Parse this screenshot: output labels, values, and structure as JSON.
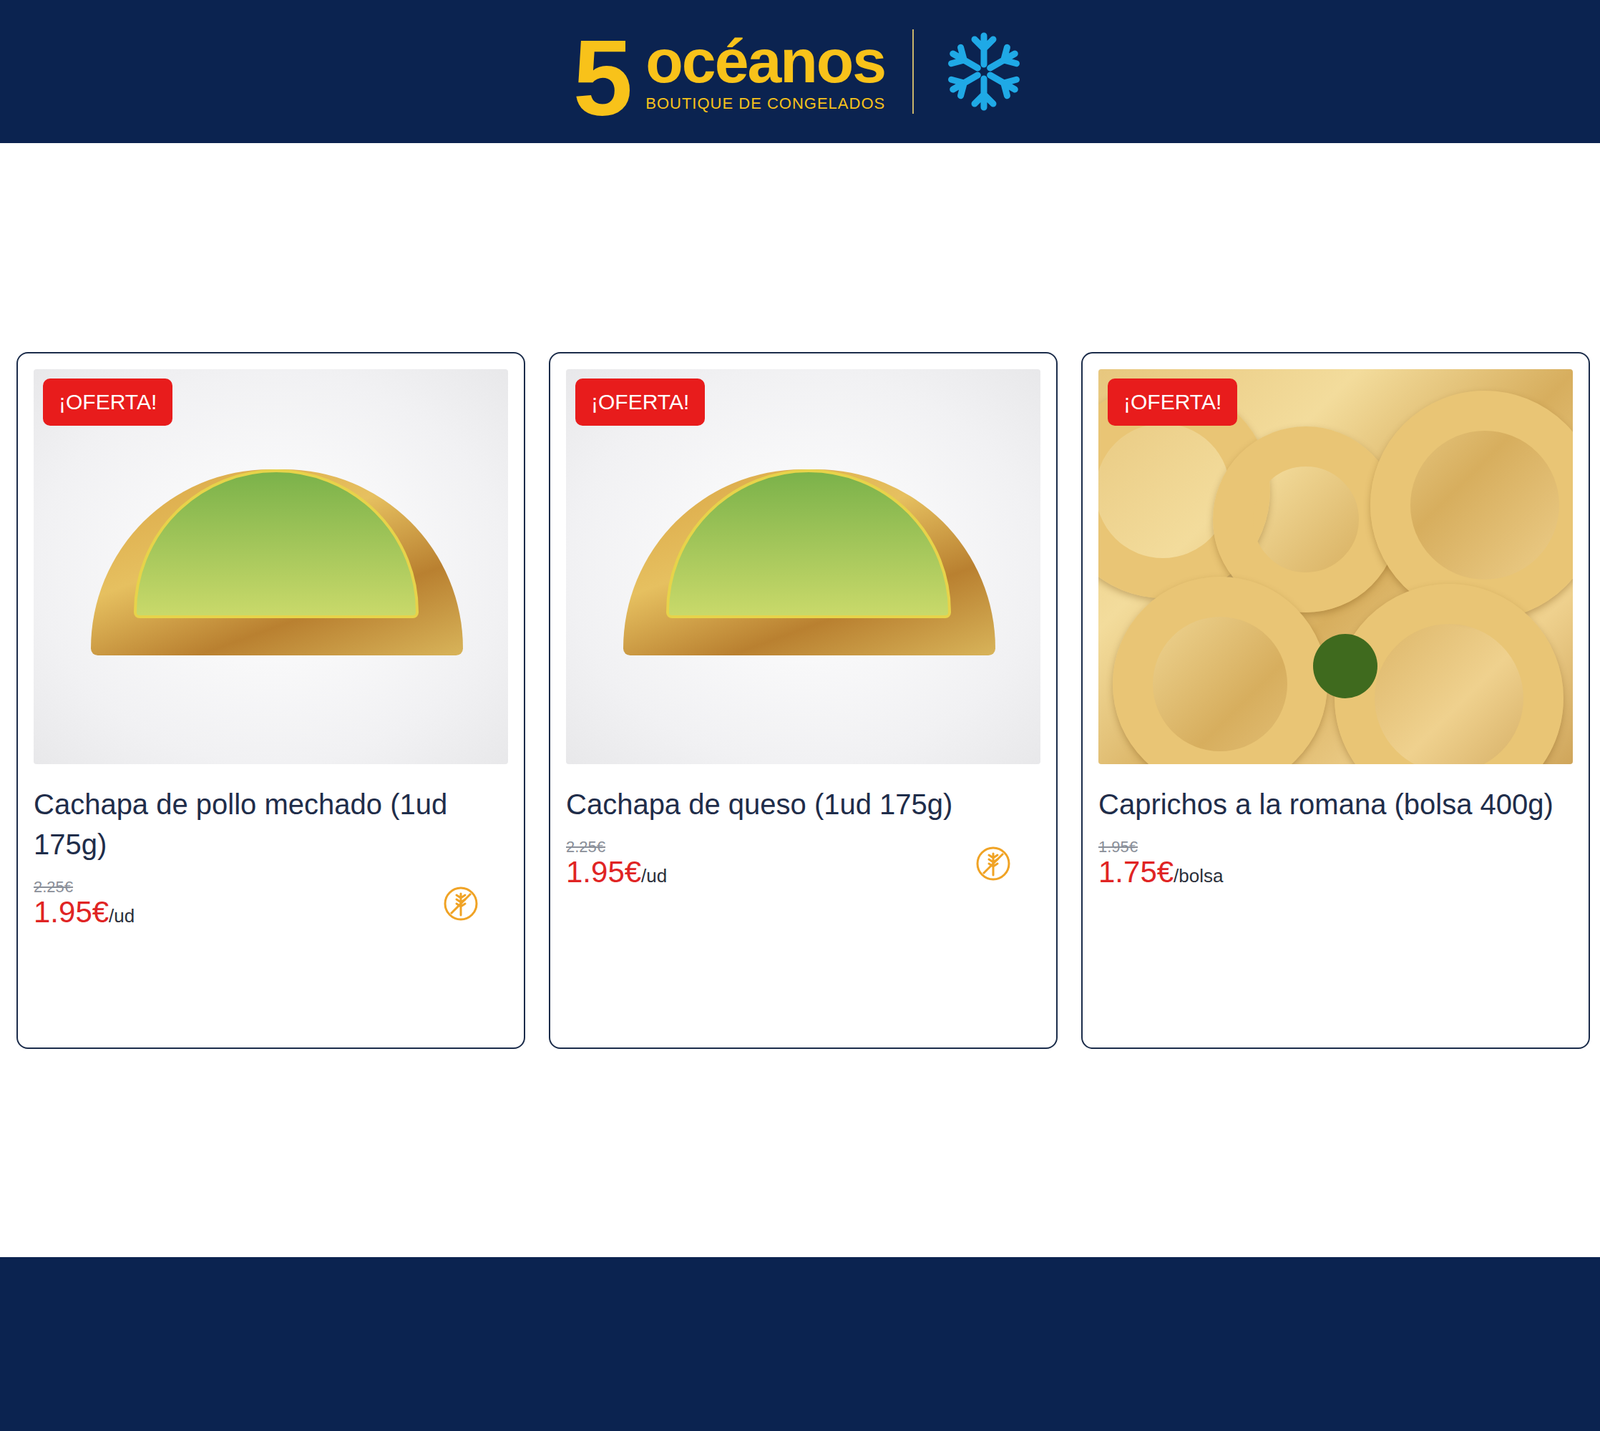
{
  "logo": {
    "digit": "5",
    "word": "océanos",
    "tagline": "BOUTIQUE DE CONGELADOS"
  },
  "products": [
    {
      "kind": "pack",
      "badge": "¡OFERTA!",
      "name": "Cachapa de pollo mechado (1ud 175g)",
      "old_price": "2.25€",
      "price": "1.95€",
      "unit": "/ud",
      "gluten_free": true
    },
    {
      "kind": "pack",
      "badge": "¡OFERTA!",
      "name": "Cachapa de queso (1ud 175g)",
      "old_price": "2.25€",
      "price": "1.95€",
      "unit": "/ud",
      "gluten_free": true
    },
    {
      "kind": "food",
      "badge": "¡OFERTA!",
      "name": "Caprichos a la romana (bolsa 400g)",
      "old_price": "1.95€",
      "price": "1.75€",
      "unit": "/bolsa",
      "gluten_free": false
    }
  ]
}
